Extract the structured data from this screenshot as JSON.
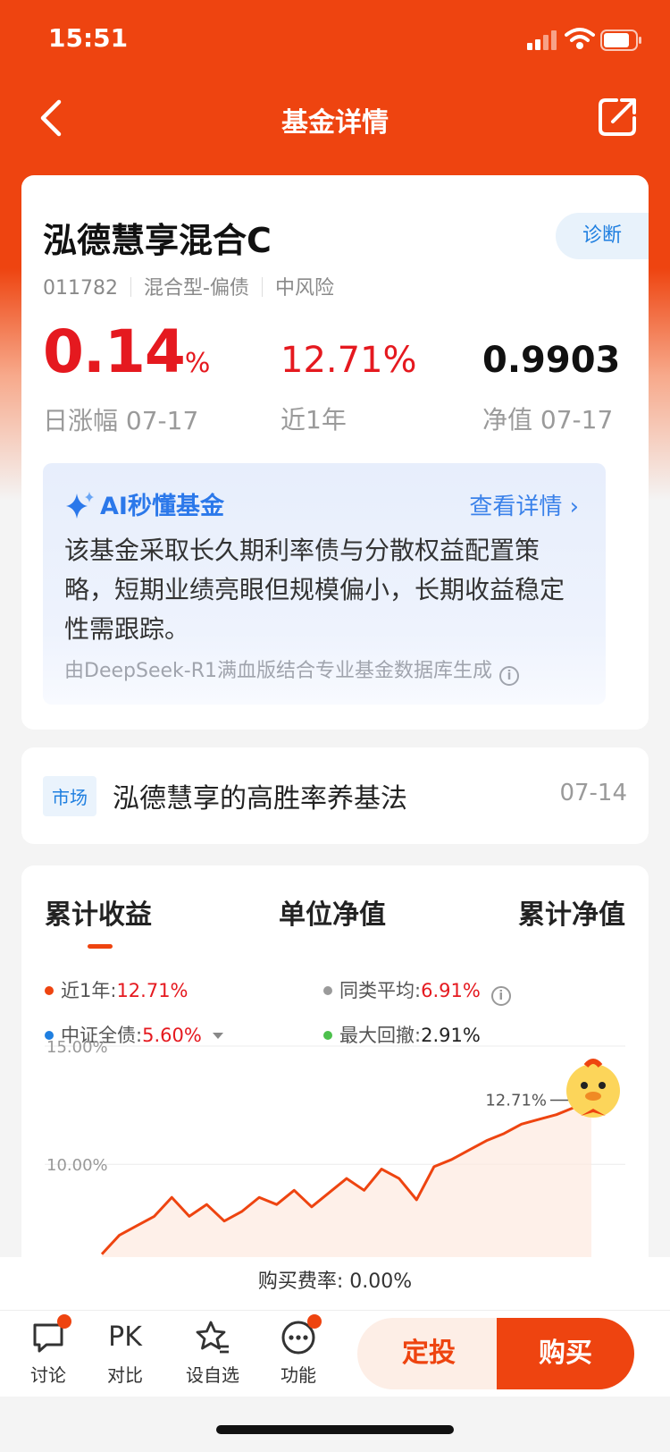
{
  "status_bar": {
    "time": "15:51"
  },
  "nav": {
    "title": "基金详情"
  },
  "fund": {
    "name": "泓德慧享混合C",
    "diagnose_label": "诊断",
    "code": "011782",
    "type": "混合型-偏债",
    "risk": "中风险",
    "daily_change_value": "0.14",
    "daily_change_unit": "%",
    "daily_change_label": "日涨幅 07-17",
    "year_return": "12.71%",
    "year_return_label": "近1年",
    "nav_value": "0.9903",
    "nav_label": "净值 07-17"
  },
  "ai": {
    "title": "AI秒懂基金",
    "link": "查看详情 ›",
    "summary": "该基金采取长久期利率债与分散权益配置策略，短期业绩亮眼但规模偏小，长期收益稳定性需跟踪。",
    "footnote": "由DeepSeek-R1满血版结合专业基金数据库生成"
  },
  "news": {
    "tag": "市场",
    "title": "泓德慧享的高胜率养基法",
    "date": "07-14"
  },
  "chart_tabs": [
    "累计收益",
    "单位净值",
    "累计净值"
  ],
  "legend": [
    {
      "label": "近1年:",
      "value": "12.71%",
      "color": "#ee4410"
    },
    {
      "label": "同类平均:",
      "value": "6.91%",
      "color": "#9a9a9a"
    },
    {
      "label": "中证全债:",
      "value": "5.60%",
      "color": "#1f7fe0"
    },
    {
      "label": "最大回撤:",
      "value": "2.91%",
      "color": "#4cc04c"
    }
  ],
  "chart_data": {
    "type": "line",
    "y_ticks": [
      "15.00%",
      "10.00%"
    ],
    "ylim": [
      6,
      15
    ],
    "end_label": "12.71%",
    "series": [
      {
        "name": "近1年",
        "color": "#ee4410",
        "values": [
          6.2,
          7.0,
          7.4,
          7.8,
          8.6,
          7.8,
          8.3,
          7.6,
          8.0,
          8.6,
          8.3,
          8.9,
          8.2,
          8.8,
          9.4,
          8.9,
          9.8,
          9.4,
          8.5,
          9.9,
          10.2,
          10.6,
          11.0,
          11.3,
          11.7,
          11.9,
          12.1,
          12.4,
          12.71
        ]
      }
    ]
  },
  "bottom": {
    "fee": "购买费率: 0.00%",
    "actions": [
      "讨论",
      "对比",
      "设自选",
      "功能"
    ],
    "pk_text": "PK",
    "btn_dingtou": "定投",
    "btn_buy": "购买"
  }
}
